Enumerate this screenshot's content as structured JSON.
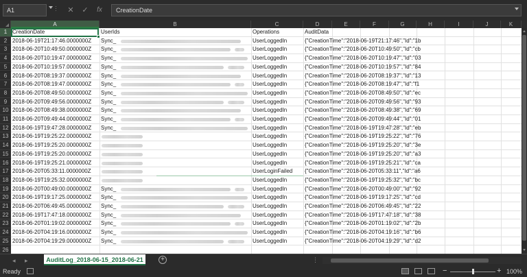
{
  "formula_bar": {
    "name_box": "A1",
    "formula": "CreationDate",
    "icons": [
      "cancel-icon",
      "enter-check-icon",
      "insert-function-icon"
    ],
    "icon_glyphs": {
      "cancel": "✕",
      "enter": "✓",
      "function": "fx"
    }
  },
  "columns": [
    "A",
    "B",
    "C",
    "D",
    "E",
    "F",
    "G",
    "H",
    "I",
    "J",
    "K"
  ],
  "header_row": [
    "CreationDate",
    "UserIds",
    "Operations",
    "AuditData"
  ],
  "rows": [
    {
      "n": "2",
      "date": "2018-06-19T21:17:46.0000000Z",
      "user": "Sync_",
      "op": "UserLoggedIn",
      "audit": "{\"CreationTime\":\"2018-06-19T21:17:46\",\"Id\":\"1b"
    },
    {
      "n": "3",
      "date": "2018-06-20T10:49:50.0000000Z",
      "user": "Sync_",
      "op": "UserLoggedIn",
      "audit": "{\"CreationTime\":\"2018-06-20T10:49:50\",\"Id\":\"cb"
    },
    {
      "n": "4",
      "date": "2018-06-20T10:19:47.0000000Z",
      "user": "Sync_",
      "op": "UserLoggedIn",
      "audit": "{\"CreationTime\":\"2018-06-20T10:19:47\",\"Id\":\"03"
    },
    {
      "n": "5",
      "date": "2018-06-20T10:19:57.0000000Z",
      "user": "Sync_",
      "op": "UserLoggedIn",
      "audit": "{\"CreationTime\":\"2018-06-20T10:19:57\",\"Id\":\"84"
    },
    {
      "n": "6",
      "date": "2018-06-20T08:19:37.0000000Z",
      "user": "Sync_",
      "op": "UserLoggedIn",
      "audit": "{\"CreationTime\":\"2018-06-20T08:19:37\",\"Id\":\"13"
    },
    {
      "n": "7",
      "date": "2018-06-20T08:19:47.0000000Z",
      "user": "Sync_",
      "op": "UserLoggedIn",
      "audit": "{\"CreationTime\":\"2018-06-20T08:19:47\",\"Id\":\"f1"
    },
    {
      "n": "8",
      "date": "2018-06-20T08:49:50.0000000Z",
      "user": "Sync_",
      "op": "UserLoggedIn",
      "audit": "{\"CreationTime\":\"2018-06-20T08:49:50\",\"Id\":\"ec"
    },
    {
      "n": "9",
      "date": "2018-06-20T09:49:56.0000000Z",
      "user": "Sync_",
      "op": "UserLoggedIn",
      "audit": "{\"CreationTime\":\"2018-06-20T09:49:56\",\"Id\":\"93"
    },
    {
      "n": "10",
      "date": "2018-06-20T08:49:38.0000000Z",
      "user": "Sync_",
      "op": "UserLoggedIn",
      "audit": "{\"CreationTime\":\"2018-06-20T08:49:38\",\"Id\":\"69"
    },
    {
      "n": "11",
      "date": "2018-06-20T09:49:44.0000000Z",
      "user": "Sync_",
      "op": "UserLoggedIn",
      "audit": "{\"CreationTime\":\"2018-06-20T09:49:44\",\"Id\":\"01"
    },
    {
      "n": "12",
      "date": "2018-06-19T19:47:28.0000000Z",
      "user": "Sync_",
      "op": "UserLoggedIn",
      "audit": "{\"CreationTime\":\"2018-06-19T19:47:28\",\"Id\":\"eb"
    },
    {
      "n": "13",
      "date": "2018-06-19T19:25:22.0000000Z",
      "user": "",
      "op": "UserLoggedIn",
      "audit": "{\"CreationTime\":\"2018-06-19T19:25:22\",\"Id\":\"76"
    },
    {
      "n": "14",
      "date": "2018-06-19T19:25:20.0000000Z",
      "user": "",
      "op": "UserLoggedIn",
      "audit": "{\"CreationTime\":\"2018-06-19T19:25:20\",\"Id\":\"3e"
    },
    {
      "n": "15",
      "date": "2018-06-19T19:25:20.0000000Z",
      "user": "",
      "op": "UserLoggedIn",
      "audit": "{\"CreationTime\":\"2018-06-19T19:25:20\",\"Id\":\"a3"
    },
    {
      "n": "16",
      "date": "2018-06-19T19:25:21.0000000Z",
      "user": "",
      "op": "UserLoggedIn",
      "audit": "{\"CreationTime\":\"2018-06-19T19:25:21\",\"Id\":\"ca"
    },
    {
      "n": "17",
      "date": "2018-06-20T05:33:11.0000000Z",
      "user": "",
      "op": "UserLoginFailed",
      "audit": "{\"CreationTime\":\"2018-06-20T05:33:11\",\"Id\":\"a6"
    },
    {
      "n": "18",
      "date": "2018-06-19T19:25:32.0000000Z",
      "user": "",
      "op": "UserLoggedIn",
      "audit": "{\"CreationTime\":\"2018-06-19T19:25:32\",\"Id\":\"bc"
    },
    {
      "n": "19",
      "date": "2018-06-20T00:49:00.0000000Z",
      "user": "Sync_",
      "op": "UserLoggedIn",
      "audit": "{\"CreationTime\":\"2018-06-20T00:49:00\",\"Id\":\"92"
    },
    {
      "n": "20",
      "date": "2018-06-19T19:17:25.0000000Z",
      "user": "Sync_",
      "op": "UserLoggedIn",
      "audit": "{\"CreationTime\":\"2018-06-19T19:17:25\",\"Id\":\"cd"
    },
    {
      "n": "21",
      "date": "2018-06-20T06:49:45.0000000Z",
      "user": "Sync_",
      "op": "UserLoggedIn",
      "audit": "{\"CreationTime\":\"2018-06-20T06:49:45\",\"Id\":\"22"
    },
    {
      "n": "22",
      "date": "2018-06-19T17:47:18.0000000Z",
      "user": "Sync_",
      "op": "UserLoggedIn",
      "audit": "{\"CreationTime\":\"2018-06-19T17:47:18\",\"Id\":\"38"
    },
    {
      "n": "23",
      "date": "2018-06-20T01:19:02.0000000Z",
      "user": "Sync_",
      "op": "UserLoggedIn",
      "audit": "{\"CreationTime\":\"2018-06-20T01:19:02\",\"Id\":\"2b"
    },
    {
      "n": "24",
      "date": "2018-06-20T04:19:16.0000000Z",
      "user": "Sync_",
      "op": "UserLoggedIn",
      "audit": "{\"CreationTime\":\"2018-06-20T04:19:16\",\"Id\":\"b6"
    },
    {
      "n": "25",
      "date": "2018-06-20T04:19:29.0000000Z",
      "user": "Sync_",
      "op": "UserLoggedIn",
      "audit": "{\"CreationTime\":\"2018-06-20T04:19:29\",\"Id\":\"d2"
    }
  ],
  "tabs": {
    "active": "AuditLog_2018-06-15_2018-06-21",
    "add_label": "+",
    "nav_prev": "◂",
    "nav_next": "▸",
    "more": "⋮"
  },
  "status": {
    "text": "Ready",
    "zoom": "100%",
    "zoom_minus": "−",
    "zoom_plus": "+",
    "view_icons": [
      "normal-view-icon",
      "page-layout-icon",
      "page-break-icon"
    ]
  },
  "colors": {
    "accent": "#217346",
    "dark_chrome": "#2b2b2b",
    "sheet": "#ffffff"
  }
}
